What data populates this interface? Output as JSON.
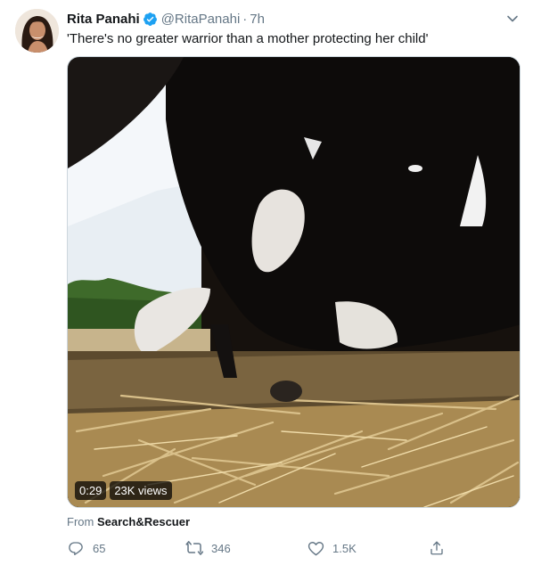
{
  "tweet": {
    "author_name": "Rita Panahi",
    "author_handle": "@RitaPanahi",
    "separator": "·",
    "timestamp": "7h",
    "text": "'There's no greater warrior than a mother protecting her child'",
    "verified": true,
    "media": {
      "type": "video",
      "duration": "0:29",
      "views": "23K views"
    },
    "source": {
      "prefix": "From",
      "name": "Search&Rescuer"
    },
    "actions": {
      "reply_count": "65",
      "retweet_count": "346",
      "like_count": "1.5K"
    }
  },
  "icons": {
    "caret": "chevron-down-icon",
    "verified": "verified-badge-icon",
    "reply": "reply-icon",
    "retweet": "retweet-icon",
    "like": "heart-icon",
    "share": "share-icon"
  },
  "colors": {
    "accent": "#1da1f2",
    "secondary_text": "#657786",
    "primary_text": "#14171a"
  }
}
